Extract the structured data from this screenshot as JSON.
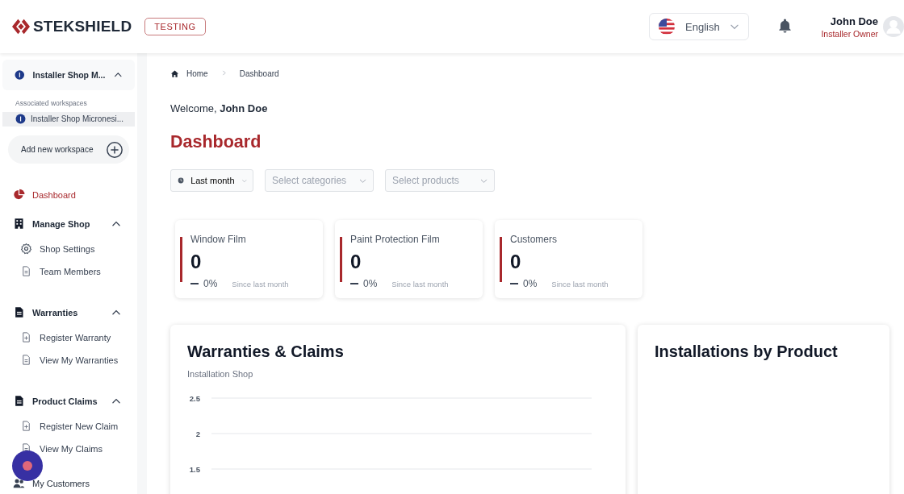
{
  "header": {
    "logo": "STEKSHIELD",
    "badge": "TESTING",
    "language": "English",
    "user": {
      "name": "John Doe",
      "role": "Installer Owner"
    }
  },
  "sidebar": {
    "workspace": {
      "current": "Installer Shop M...",
      "expanded": true,
      "associated_label": "Associated workspaces",
      "items": [
        {
          "name": "Installer Shop Micronesi...",
          "selected": true
        }
      ],
      "add_label": "Add new workspace"
    },
    "nav": [
      {
        "kind": "link",
        "label": "Dashboard",
        "selected": true
      },
      {
        "kind": "group",
        "label": "Manage Shop",
        "expanded": true,
        "children": [
          {
            "label": "Shop Settings",
            "selected": false
          },
          {
            "label": "Team Members",
            "selected": false
          }
        ]
      },
      {
        "kind": "group",
        "label": "Warranties",
        "expanded": true,
        "children": [
          {
            "label": "Register Warranty",
            "selected": false
          },
          {
            "label": "View My Warranties",
            "selected": false
          }
        ]
      },
      {
        "kind": "group",
        "label": "Product Claims",
        "expanded": true,
        "children": [
          {
            "label": "Register New Claim",
            "selected": false
          },
          {
            "label": "View My Claims",
            "selected": false
          }
        ]
      },
      {
        "kind": "link",
        "label": "My Customers",
        "selected": false
      }
    ]
  },
  "breadcrumb": [
    "Home",
    "Dashboard"
  ],
  "welcome": "Welcome, **John Doe**",
  "title": "Dashboard",
  "filters": [
    {
      "kind": "period",
      "value": "Last month"
    },
    {
      "kind": "select",
      "placeholder": "Select categories"
    },
    {
      "kind": "select",
      "placeholder": "Select products"
    }
  ],
  "stats": [
    {
      "label": "Window Film",
      "value": "0",
      "change": "0%",
      "note": "Since last month"
    },
    {
      "label": "Paint Protection Film",
      "value": "0",
      "change": "0%",
      "note": "Since last month"
    },
    {
      "label": "Customers",
      "value": "0",
      "change": "0%",
      "note": "Since last month"
    }
  ],
  "panels": [
    {
      "title": "Warranties & Claims",
      "subtitle": "Installation Shop",
      "y_ticks": [
        "2.5",
        "2",
        "1.5"
      ]
    },
    {
      "title": "Installations by Product"
    }
  ]
}
